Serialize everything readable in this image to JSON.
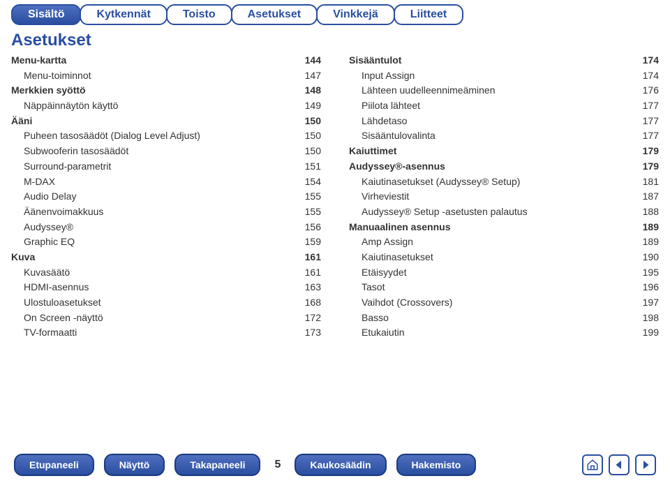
{
  "tabs": {
    "t0": "Sisältö",
    "t1": "Kytkennät",
    "t2": "Toisto",
    "t3": "Asetukset",
    "t4": "Vinkkejä",
    "t5": "Liitteet"
  },
  "title": "Asetukset",
  "left": [
    {
      "label": "Menu-kartta",
      "page": "144",
      "indent": 0,
      "bold": true
    },
    {
      "label": "Menu-toiminnot",
      "page": "147",
      "indent": 1,
      "bold": false
    },
    {
      "label": "Merkkien syöttö",
      "page": "148",
      "indent": 0,
      "bold": true
    },
    {
      "label": "Näppäinnäytön käyttö",
      "page": "149",
      "indent": 1,
      "bold": false
    },
    {
      "label": "Ääni",
      "page": "150",
      "indent": 0,
      "bold": true
    },
    {
      "label": "Puheen tasosäädöt (Dialog Level Adjust)",
      "page": "150",
      "indent": 1,
      "bold": false
    },
    {
      "label": "Subwooferin tasosäädöt",
      "page": "150",
      "indent": 1,
      "bold": false
    },
    {
      "label": "Surround-parametrit",
      "page": "151",
      "indent": 1,
      "bold": false
    },
    {
      "label": "M-DAX",
      "page": "154",
      "indent": 1,
      "bold": false
    },
    {
      "label": "Audio Delay",
      "page": "155",
      "indent": 1,
      "bold": false
    },
    {
      "label": "Äänenvoimakkuus",
      "page": "155",
      "indent": 1,
      "bold": false
    },
    {
      "label": "Audyssey®",
      "page": "156",
      "indent": 1,
      "bold": false
    },
    {
      "label": "Graphic EQ",
      "page": "159",
      "indent": 1,
      "bold": false
    },
    {
      "label": "Kuva",
      "page": "161",
      "indent": 0,
      "bold": true
    },
    {
      "label": "Kuvasäätö",
      "page": "161",
      "indent": 1,
      "bold": false
    },
    {
      "label": "HDMI-asennus",
      "page": "163",
      "indent": 1,
      "bold": false
    },
    {
      "label": "Ulostuloasetukset",
      "page": "168",
      "indent": 1,
      "bold": false
    },
    {
      "label": "On Screen -näyttö",
      "page": "172",
      "indent": 1,
      "bold": false
    },
    {
      "label": "TV-formaatti",
      "page": "173",
      "indent": 1,
      "bold": false
    }
  ],
  "right": [
    {
      "label": "Sisääntulot",
      "page": "174",
      "indent": 0,
      "bold": true
    },
    {
      "label": "Input Assign",
      "page": "174",
      "indent": 1,
      "bold": false
    },
    {
      "label": "Lähteen uudelleennimeäminen",
      "page": "176",
      "indent": 1,
      "bold": false
    },
    {
      "label": "Piilota lähteet",
      "page": "177",
      "indent": 1,
      "bold": false
    },
    {
      "label": "Lähdetaso",
      "page": "177",
      "indent": 1,
      "bold": false
    },
    {
      "label": "Sisääntulovalinta",
      "page": "177",
      "indent": 1,
      "bold": false
    },
    {
      "label": "Kaiuttimet",
      "page": "179",
      "indent": 0,
      "bold": true
    },
    {
      "label": "Audyssey®-asennus",
      "page": "179",
      "indent": 0,
      "bold": true
    },
    {
      "label": "Kaiutinasetukset (Audyssey® Setup)",
      "page": "181",
      "indent": 1,
      "bold": false
    },
    {
      "label": "Virheviestit",
      "page": "187",
      "indent": 1,
      "bold": false
    },
    {
      "label": "Audyssey® Setup -asetusten palautus",
      "page": "188",
      "indent": 1,
      "bold": false
    },
    {
      "label": "Manuaalinen asennus",
      "page": "189",
      "indent": 0,
      "bold": true
    },
    {
      "label": "Amp Assign",
      "page": "189",
      "indent": 1,
      "bold": false
    },
    {
      "label": "Kaiutinasetukset",
      "page": "190",
      "indent": 1,
      "bold": false
    },
    {
      "label": "Etäisyydet",
      "page": "195",
      "indent": 1,
      "bold": false
    },
    {
      "label": "Tasot",
      "page": "196",
      "indent": 1,
      "bold": false
    },
    {
      "label": "Vaihdot (Crossovers)",
      "page": "197",
      "indent": 1,
      "bold": false
    },
    {
      "label": "Basso",
      "page": "198",
      "indent": 1,
      "bold": false
    },
    {
      "label": "Etukaiutin",
      "page": "199",
      "indent": 1,
      "bold": false
    }
  ],
  "bottom": {
    "b0": "Etupaneeli",
    "b1": "Näyttö",
    "b2": "Takapaneeli",
    "b3": "Kaukosäädin",
    "b4": "Hakemisto",
    "page_num": "5"
  }
}
